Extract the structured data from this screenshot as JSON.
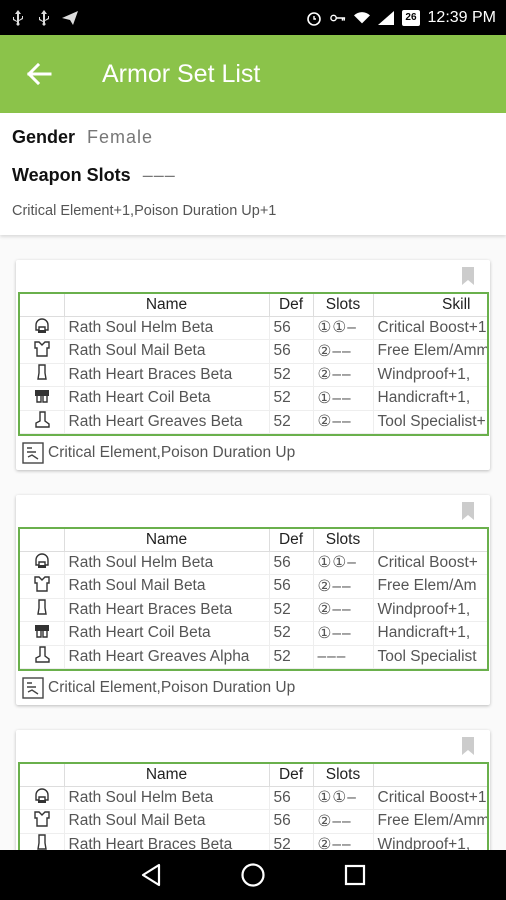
{
  "status_bar": {
    "time": "12:39 PM",
    "battery": "26",
    "left_icons": [
      "usb-icon",
      "usb-icon",
      "send-icon"
    ],
    "right_icons": [
      "alarm-icon",
      "key-icon",
      "wifi-icon",
      "signal-icon"
    ]
  },
  "app_bar": {
    "title": "Armor Set List",
    "back_icon": "arrow-left-icon",
    "color": "#8bc34a"
  },
  "filters": {
    "gender_label": "Gender",
    "gender_value": "Female",
    "weapon_label": "Weapon Slots",
    "weapon_value": "–––",
    "skills": "Critical Element+1,Poison Duration Up+1"
  },
  "columns": {
    "name": "Name",
    "def": "Def",
    "slots": "Slots",
    "skill": "Skill"
  },
  "sets": [
    {
      "rows": [
        {
          "icon": "helm-icon",
          "name": "Rath Soul Helm Beta",
          "def": "56",
          "slots": "①①–",
          "skill": "Critical Boost+1"
        },
        {
          "icon": "mail-icon",
          "name": "Rath Soul Mail Beta",
          "def": "56",
          "slots": "②––",
          "skill": "Free Elem/Ammo"
        },
        {
          "icon": "braces-icon",
          "name": "Rath Heart Braces Beta",
          "def": "52",
          "slots": "②––",
          "skill": "Windproof+1,"
        },
        {
          "icon": "coil-icon",
          "name": "Rath Heart Coil Beta",
          "def": "52",
          "slots": "①––",
          "skill": "Handicraft+1,"
        },
        {
          "icon": "greaves-icon",
          "name": "Rath Heart Greaves Beta",
          "def": "52",
          "slots": "②––",
          "skill": "Tool Specialist+"
        }
      ],
      "footer": "Critical Element,Poison Duration Up"
    },
    {
      "rows": [
        {
          "icon": "helm-icon",
          "name": "Rath Soul Helm Beta",
          "def": "56",
          "slots": "①①–",
          "skill": "Critical Boost+"
        },
        {
          "icon": "mail-icon",
          "name": "Rath Soul Mail Beta",
          "def": "56",
          "slots": "②––",
          "skill": "Free Elem/Am"
        },
        {
          "icon": "braces-icon",
          "name": "Rath Heart Braces Beta",
          "def": "52",
          "slots": "②––",
          "skill": "Windproof+1,"
        },
        {
          "icon": "coil-icon",
          "name": "Rath Heart Coil Beta",
          "def": "52",
          "slots": "①––",
          "skill": "Handicraft+1,"
        },
        {
          "icon": "greaves-icon",
          "name": "Rath Heart Greaves Alpha",
          "def": "52",
          "slots": "–––",
          "skill": "Tool Specialist"
        }
      ],
      "footer": "Critical Element,Poison Duration Up"
    },
    {
      "rows": [
        {
          "icon": "helm-icon",
          "name": "Rath Soul Helm Beta",
          "def": "56",
          "slots": "①①–",
          "skill": "Critical Boost+1"
        },
        {
          "icon": "mail-icon",
          "name": "Rath Soul Mail Beta",
          "def": "56",
          "slots": "②––",
          "skill": "Free Elem/Amm"
        },
        {
          "icon": "braces-icon",
          "name": "Rath Heart Braces Beta",
          "def": "52",
          "slots": "②––",
          "skill": "Windproof+1,"
        }
      ],
      "footer": ""
    }
  ],
  "nav": {
    "back": "nav-back-icon",
    "home": "nav-home-icon",
    "recents": "nav-recents-icon"
  }
}
